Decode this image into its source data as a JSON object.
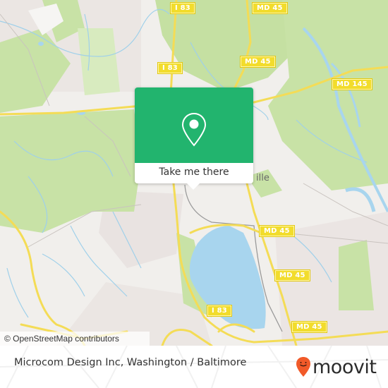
{
  "map": {
    "attribution": "© OpenStreetMap contributors",
    "road_labels": [
      {
        "id": "i83-top",
        "text": "I 83"
      },
      {
        "id": "md45-top",
        "text": "MD 45"
      },
      {
        "id": "i83-mid",
        "text": "I 83"
      },
      {
        "id": "md45-mid",
        "text": "MD 45"
      },
      {
        "id": "md145",
        "text": "MD 145"
      },
      {
        "id": "md45-east1",
        "text": "MD 45"
      },
      {
        "id": "md45-east2",
        "text": "MD 45"
      },
      {
        "id": "i83-south",
        "text": "I 83"
      },
      {
        "id": "md45-south",
        "text": "MD 45"
      }
    ],
    "partial_place_label": "ille",
    "colors": {
      "land": "#f1efec",
      "forest": "#c8e2a6",
      "water": "#a8d5ee",
      "road": "#f4dc56",
      "urban": "#e9e3e1"
    }
  },
  "popup": {
    "icon": "map-pin-icon",
    "button_label": "Take me there",
    "color": "#22b46e"
  },
  "footer": {
    "title": "Microcom Design Inc, Washington / Baltimore",
    "brand": "moovit",
    "brand_icon": "moovit-smile-pin-icon",
    "brand_color": "#f15a29"
  }
}
